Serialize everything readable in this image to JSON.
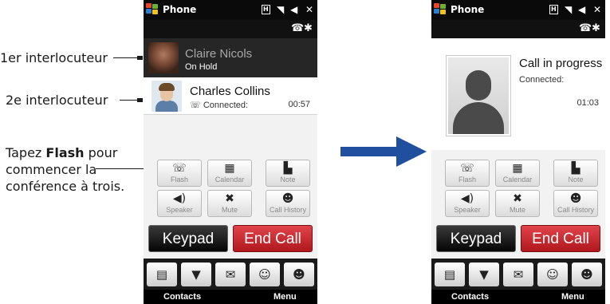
{
  "annotations": {
    "first_caller": "1er interlocuteur",
    "second_caller": "2e interlocuteur",
    "flash_line1_pre": "Tapez ",
    "flash_line1_bold": "Flash",
    "flash_line1_post": " pour",
    "flash_line2": "commencer la",
    "flash_line3": "conférence à trois."
  },
  "status_bar": {
    "title": "Phone",
    "h_icon": "H",
    "close": "✕"
  },
  "left_screen": {
    "held_caller": {
      "name": "Claire Nicols",
      "state": "On Hold"
    },
    "active_caller": {
      "name": "Charles Collins",
      "state": "Connected:",
      "timer": "00:57"
    }
  },
  "right_screen": {
    "title": "Call in progress",
    "connected": "Connected:",
    "timer": "01:03"
  },
  "buttons": {
    "flash": "Flash",
    "calendar": "Calendar",
    "note": "Note",
    "speaker": "Speaker",
    "mute": "Mute",
    "call_history": "Call History",
    "keypad": "Keypad",
    "end_call": "End Call"
  },
  "softkeys": {
    "left": "Contacts",
    "right": "Menu"
  },
  "icons": {
    "windows": "windows-logo-icon",
    "signal": "signal-icon",
    "volume": "speaker-volume-icon",
    "flash": "flash-phone-icon",
    "calendar": "calendar-icon",
    "note": "note-icon",
    "speaker": "speaker-icon",
    "mute": "mute-microphone-icon",
    "call_history": "call-history-icon",
    "contact_card": "contact-card-icon",
    "message": "message-icon",
    "email": "email-icon",
    "recent_contact": "recent-contact-icon",
    "people": "people-icon"
  },
  "colors": {
    "end_call": "#c8232a",
    "arrow": "#1f4f9e",
    "status_bar": "#0a0a0a"
  }
}
